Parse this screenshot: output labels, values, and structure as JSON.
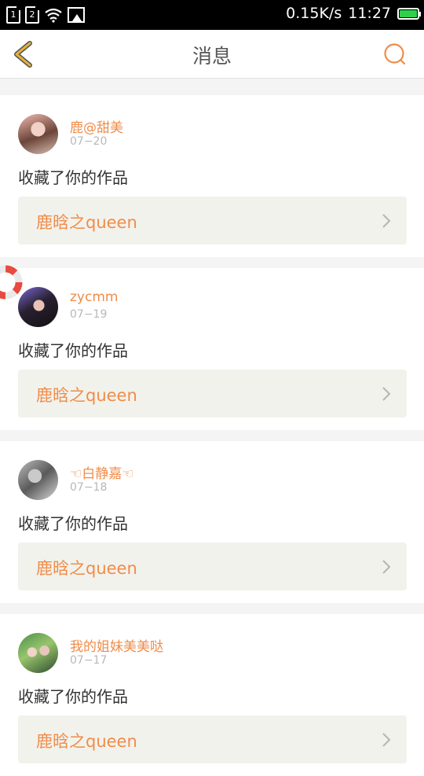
{
  "status_bar": {
    "sim1": "1",
    "sim2": "2",
    "speed": "0.15K/s",
    "time": "11:27"
  },
  "header": {
    "title": "消息"
  },
  "messages": [
    {
      "username": "鹿@甜美",
      "date": "07−20",
      "action": "收藏了你的作品",
      "work_title": "鹿晗之queen"
    },
    {
      "username": "zycmm",
      "date": "07−19",
      "action": "收藏了你的作品",
      "work_title": "鹿晗之queen"
    },
    {
      "username": "☜白静嘉☜",
      "date": "07−18",
      "action": "收藏了你的作品",
      "work_title": "鹿晗之queen"
    },
    {
      "username": "我的姐妹美美哒",
      "date": "07−17",
      "action": "收藏了你的作品",
      "work_title": "鹿晗之queen"
    }
  ],
  "colors": {
    "accent": "#f08c4a",
    "back_arrow": "#e8b23a"
  }
}
